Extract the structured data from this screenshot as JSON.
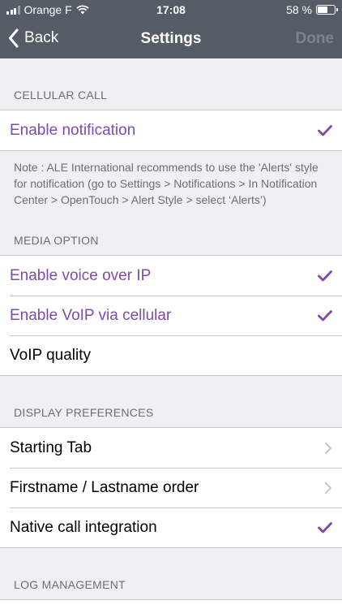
{
  "status": {
    "carrier": "Orange F",
    "time": "17:08",
    "battery": "58 %",
    "battery_level": 0.58
  },
  "nav": {
    "back_label": "Back",
    "title": "Settings",
    "done_label": "Done"
  },
  "cellular": {
    "header": "CELLULAR CALL",
    "enable_notification": "Enable notification",
    "note": "Note : ALE International recommends to use the 'Alerts' style for notification (go to Settings > Notifications > In Notification Center > OpenTouch > Alert Style > select ‘Alerts’)"
  },
  "media": {
    "header": "MEDIA OPTION",
    "voip": "Enable voice over IP",
    "voip_cellular": "Enable VoIP via cellular",
    "voip_quality": "VoIP quality"
  },
  "display": {
    "header": "DISPLAY PREFERENCES",
    "starting_tab": "Starting Tab",
    "name_order": "Firstname / Lastname order",
    "native_call": "Native call integration"
  },
  "log": {
    "header": "LOG MANAGEMENT"
  },
  "colors": {
    "accent": "#7e4ba9",
    "navbar": "#565c66"
  },
  "icons": {
    "checkmark": "checkmark-icon",
    "chevron": "chevron-right-icon",
    "back": "chevron-left-icon"
  }
}
